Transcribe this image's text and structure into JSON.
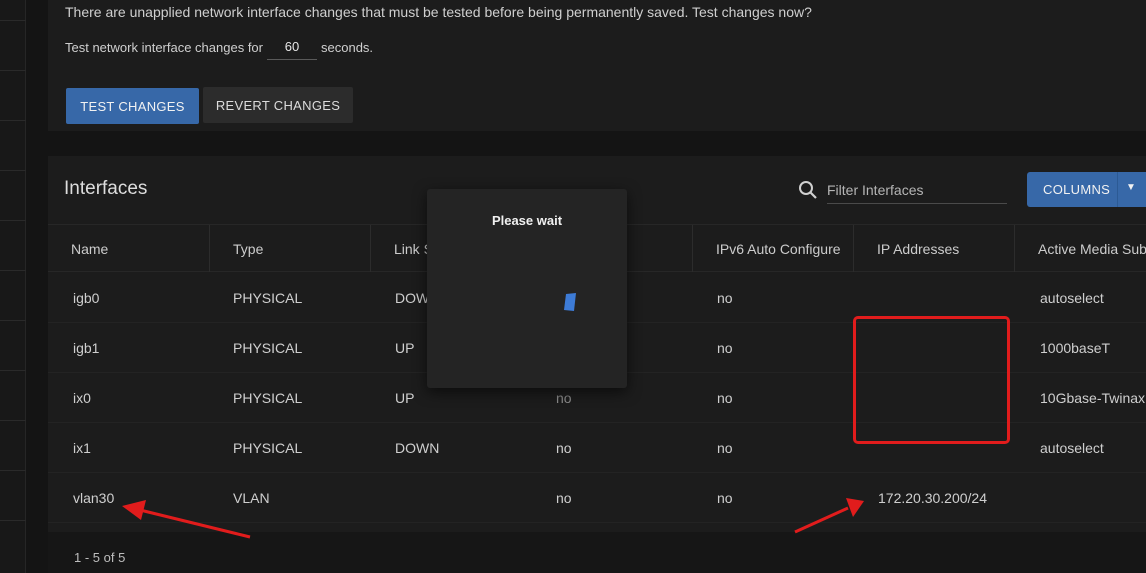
{
  "notice": {
    "message": "There are unapplied network interface changes that must be tested before being permanently saved. Test changes now?",
    "test_prefix": "Test network interface changes for",
    "seconds_value": "60",
    "test_suffix": "seconds.",
    "test_button": "TEST CHANGES",
    "revert_button": "REVERT CHANGES"
  },
  "interfaces": {
    "title": "Interfaces",
    "filter_placeholder": "Filter Interfaces",
    "columns_button": "COLUMNS",
    "headers": [
      "Name",
      "Type",
      "Link State",
      "",
      "IPv6 Auto Configure",
      "IP Addresses",
      "Active Media Subtype"
    ],
    "rows": [
      {
        "name": "igb0",
        "type": "PHYSICAL",
        "link": "DOWN",
        "dhcp": "",
        "ipv6": "no",
        "ip": "",
        "media": "autoselect"
      },
      {
        "name": "igb1",
        "type": "PHYSICAL",
        "link": "UP",
        "dhcp": "",
        "ipv6": "no",
        "ip": "",
        "media": "1000baseT"
      },
      {
        "name": "ix0",
        "type": "PHYSICAL",
        "link": "UP",
        "dhcp": "no",
        "ipv6": "no",
        "ip": "",
        "media": "10Gbase-Twinax"
      },
      {
        "name": "ix1",
        "type": "PHYSICAL",
        "link": "DOWN",
        "dhcp": "no",
        "ipv6": "no",
        "ip": "",
        "media": "autoselect"
      },
      {
        "name": "vlan30",
        "type": "VLAN",
        "link": "",
        "dhcp": "no",
        "ipv6": "no",
        "ip": "172.20.30.200/24",
        "media": ""
      }
    ],
    "pager": "1 - 5 of 5"
  },
  "dialog": {
    "title": "Please wait"
  },
  "colors": {
    "accent": "#3768a8",
    "annotation": "#e11c1c"
  }
}
